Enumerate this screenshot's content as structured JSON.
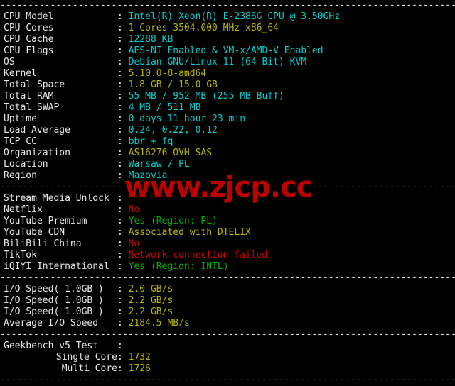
{
  "terminal": {
    "separator_char": "-",
    "colon": ":",
    "watermark": "www.zjcp.cc",
    "colors": {
      "background": "#000000",
      "label": "#e8e8e8",
      "cyan": "#00cdcd",
      "olive": "#b7b700",
      "green": "#00af00",
      "red": "#cc0000",
      "watermark": "#bb0000"
    }
  },
  "sections": [
    {
      "name": "system-info",
      "rows": [
        {
          "label": "CPU Model",
          "value": "Intel(R) Xeon(R) E-2386G CPU @ 3.50GHz",
          "color": "cyan",
          "align": "left"
        },
        {
          "label": "CPU Cores",
          "value": "1 Cores 3504.000 MHz x86_64",
          "color": "olive",
          "align": "left"
        },
        {
          "label": "CPU Cache",
          "value": "12288 KB",
          "color": "cyan",
          "align": "left"
        },
        {
          "label": "CPU Flags",
          "value": "AES-NI Enabled & VM-x/AMD-V Enabled",
          "color": "cyan",
          "align": "left"
        },
        {
          "label": "OS",
          "value": "Debian GNU/Linux 11 (64 Bit) KVM",
          "color": "cyan",
          "align": "left"
        },
        {
          "label": "Kernel",
          "value": "5.10.0-8-amd64",
          "color": "olive",
          "align": "left"
        },
        {
          "label": "Total Space",
          "value": "1.8 GB / 15.0 GB",
          "color": "olive",
          "align": "left"
        },
        {
          "label": "Total RAM",
          "value": "55 MB / 952 MB (255 MB Buff)",
          "color": "cyan",
          "align": "left"
        },
        {
          "label": "Total SWAP",
          "value": "4 MB / 511 MB",
          "color": "cyan",
          "align": "left"
        },
        {
          "label": "Uptime",
          "value": "0 days 11 hour 23 min",
          "color": "cyan",
          "align": "left"
        },
        {
          "label": "Load Average",
          "value": "0.24, 0.22, 0.12",
          "color": "cyan",
          "align": "left"
        },
        {
          "label": "TCP CC",
          "value": "bbr + fq",
          "color": "cyan",
          "align": "left"
        },
        {
          "label": "Organization",
          "value": "AS16276 OVH SAS",
          "color": "olive",
          "align": "left"
        },
        {
          "label": "Location",
          "value": "Warsaw / PL",
          "color": "cyan",
          "align": "left"
        },
        {
          "label": "Region",
          "value": "Mazovia",
          "color": "cyan",
          "align": "left"
        }
      ]
    },
    {
      "name": "stream-media-unlock",
      "rows": [
        {
          "label": "Stream Media Unlock",
          "value": "",
          "color": "white",
          "align": "left"
        },
        {
          "label": "Netflix",
          "value": "No",
          "color": "red",
          "align": "left"
        },
        {
          "label": "YouTube Premium",
          "value": "Yes (Region: PL)",
          "color": "green",
          "align": "left"
        },
        {
          "label": "YouTube CDN",
          "value": "Associated with DTELIX",
          "color": "olive",
          "align": "left"
        },
        {
          "label": "BiliBili China",
          "value": "No",
          "color": "red",
          "align": "left"
        },
        {
          "label": "TikTok",
          "value": "Network connection failed",
          "color": "red",
          "align": "left"
        },
        {
          "label": "iQIYI International",
          "value": "Yes (Region: INTL)",
          "color": "green",
          "align": "left"
        }
      ]
    },
    {
      "name": "io-speed",
      "rows": [
        {
          "label": "I/O Speed( 1.0GB )",
          "value": "2.0 GB/s",
          "color": "olive",
          "align": "left"
        },
        {
          "label": "I/O Speed( 1.0GB )",
          "value": "2.2 GB/s",
          "color": "olive",
          "align": "left"
        },
        {
          "label": "I/O Speed( 1.0GB )",
          "value": "2.2 GB/s",
          "color": "olive",
          "align": "left"
        },
        {
          "label": "Average I/O Speed",
          "value": "2184.5 MB/s",
          "color": "olive",
          "align": "left"
        }
      ]
    },
    {
      "name": "geekbench",
      "rows": [
        {
          "label": "Geekbench v5 Test",
          "value": "",
          "color": "white",
          "align": "left"
        },
        {
          "label": "Single Core",
          "value": "1732",
          "color": "olive",
          "align": "right"
        },
        {
          "label": "Multi Core",
          "value": "1726",
          "color": "olive",
          "align": "right"
        }
      ]
    }
  ]
}
